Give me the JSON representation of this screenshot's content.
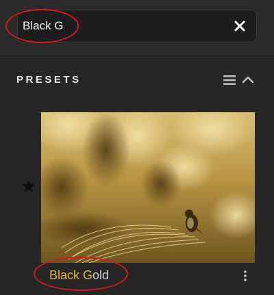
{
  "search": {
    "value": "Black G",
    "clear_icon": "close-icon"
  },
  "presets": {
    "title": "PRESETS",
    "menu_icon": "hamburger-icon",
    "collapse_icon": "chevron-up-icon",
    "items": [
      {
        "name_match": "Black G",
        "name_rest": "old",
        "favorite_icon": "star-icon",
        "more_icon": "vertical-ellipsis-icon",
        "thumbnail": "golden-toned photo of a small bird perched on a feathery plume"
      }
    ]
  },
  "colors": {
    "background": "#2a2a2a",
    "panel": "#262626",
    "highlight_text": "#e8b53a",
    "annotation": "#d11b1b"
  }
}
